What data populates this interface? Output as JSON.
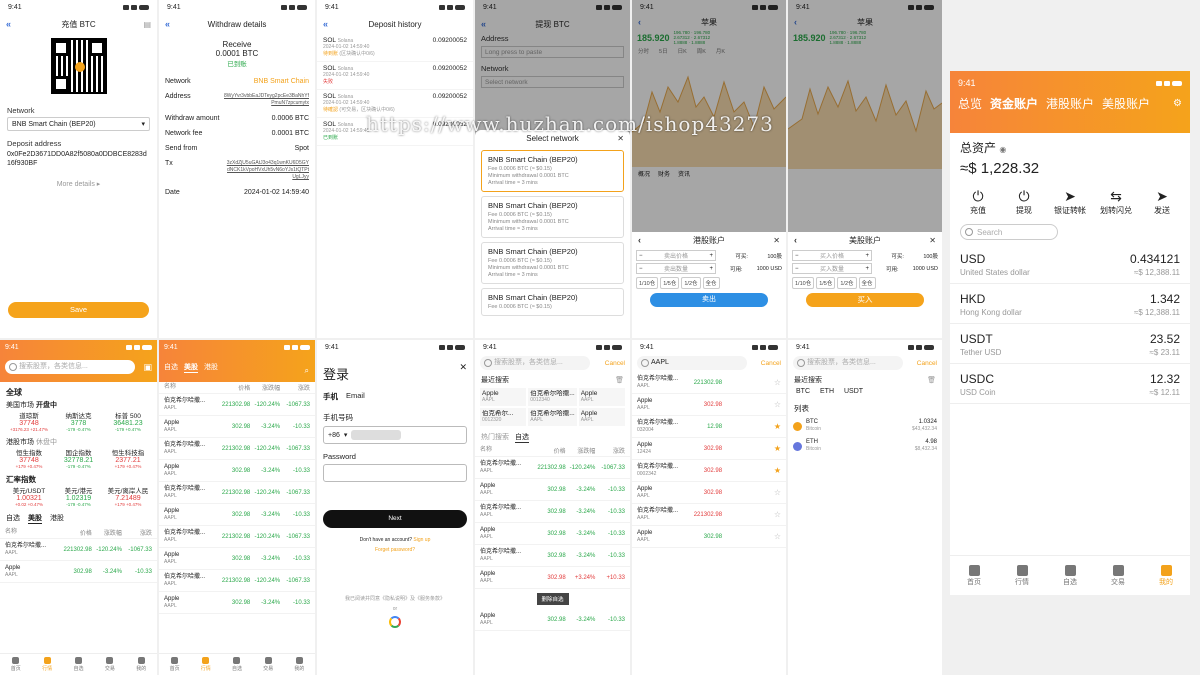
{
  "watermark": "https://www.huzhan.com/ishop43273",
  "time": "9:41",
  "p1": {
    "title": "充值 BTC",
    "network_label": "Network",
    "network_value": "BNB Smart Chain (BEP20)",
    "addr_label": "Deposit address",
    "addr_value": "0x0Fe2D3671DD0A82f5080a0DDBCE8283d16f930BF",
    "more": "More details",
    "save": "Save"
  },
  "p2": {
    "title": "Withdraw details",
    "receive": "Receive",
    "amount": "0.0001 BTC",
    "status": "已到账",
    "rows": [
      {
        "k": "Network",
        "v": "BNB Smart Chain"
      },
      {
        "k": "Address",
        "v": "8WyYvr3vbbEaJDTeyg2pcEe3BaNhYfPmuN7zpcumytx"
      },
      {
        "k": "Withdraw amount",
        "v": "0.0006 BTC"
      },
      {
        "k": "Network fee",
        "v": "0.0001 BTC"
      },
      {
        "k": "Send from",
        "v": "Spot"
      },
      {
        "k": "Tx",
        "v": "3zXdZjU5uGAtJ3o43q1wnKU6D5GYdNCK1kVpoHVxUh5vN6oYJs1tQTPtUgLJyy"
      },
      {
        "k": "Date",
        "v": "2024-01-02 14:59:40"
      }
    ]
  },
  "p3": {
    "title": "Deposit history",
    "items": [
      {
        "coin": "SOL",
        "net": "Solana",
        "amt": "0.09200052",
        "date": "2024-01-02 14:59:40",
        "status": "待到账",
        "note": "(区块确认中0/6)"
      },
      {
        "coin": "SOL",
        "net": "Solana",
        "amt": "0.09200052",
        "date": "2024-01-02 14:59:40",
        "status": "失败",
        "note": ""
      },
      {
        "coin": "SOL",
        "net": "Solana",
        "amt": "0.09200052",
        "date": "2024-01-02 14:59:40",
        "status": "待確認",
        "note": "(可交易，区块确认中0/6)"
      },
      {
        "coin": "SOL",
        "net": "Solana",
        "amt": "0.09200052",
        "date": "2024-01-02 14:59:40",
        "status": "已到账",
        "note": ""
      }
    ]
  },
  "p4": {
    "title": "提现 BTC",
    "address_label": "Address",
    "address_ph": "Long press to paste",
    "network_label": "Network",
    "network_ph": "Select network",
    "sheet_title": "Select network",
    "cards": [
      {
        "name": "BNB Smart Chain (BEP20)",
        "fee": "Fee 0.0006 BTC (≈ $0.15)",
        "min": "Minimum withdrawal 0.0001 BTC",
        "time": "Arrival time ≈ 3 mins"
      },
      {
        "name": "BNB Smart Chain (BEP20)",
        "fee": "Fee 0.0006 BTC (≈ $0.15)",
        "min": "Minimum withdrawal 0.0001 BTC",
        "time": "Arrival time ≈ 3 mins"
      },
      {
        "name": "BNB Smart Chain (BEP20)",
        "fee": "Fee 0.0006 BTC (≈ $0.15)",
        "min": "Minimum withdrawal 0.0001 BTC",
        "time": "Arrival time ≈ 3 mins"
      },
      {
        "name": "BNB Smart Chain (BEP20)",
        "fee": "Fee 0.0006 BTC (≈ $0.15)",
        "min": "",
        "time": ""
      }
    ]
  },
  "p5": {
    "title": "苹果",
    "price": "185.920",
    "tabs": [
      "分时",
      "5日",
      "日K",
      "周K",
      "月K"
    ],
    "subtabs": [
      "概况",
      "财务",
      "资讯"
    ],
    "sheet_title": "港股账户",
    "price_ph": "卖出价格",
    "qty_ph": "卖出数量",
    "buyable_label": "可买:",
    "buyable_val": "100股",
    "avail_label": "可用:",
    "avail_val": "1000 USD",
    "fracs": [
      "1/10仓",
      "1/5仓",
      "1/2仓",
      "全仓"
    ],
    "action": "卖出"
  },
  "p6": {
    "title": "苹果",
    "price": "185.920",
    "sheet_title": "美股账户",
    "price_ph": "买入价格",
    "qty_ph": "买入数量",
    "buyable_label": "可买:",
    "buyable_val": "100股",
    "avail_label": "可用:",
    "avail_val": "1000 USD",
    "fracs": [
      "1/10仓",
      "1/5仓",
      "1/2仓",
      "全仓"
    ],
    "action": "买入"
  },
  "p7": {
    "tabs": [
      "总览",
      "资金账户",
      "港股账户",
      "美股账户"
    ],
    "total_label": "总资产",
    "total": "≈$ 1,228.32",
    "actions": [
      "充值",
      "提现",
      "银证转帐",
      "划转闪兑",
      "发送"
    ],
    "search_ph": "Search",
    "assets": [
      {
        "code": "USD",
        "name": "United States dollar",
        "amt": "0.434121",
        "usd": "≈$ 12,388.11"
      },
      {
        "code": "HKD",
        "name": "Hong Kong dollar",
        "amt": "1.342",
        "usd": "≈$ 12,388.11"
      },
      {
        "code": "USDT",
        "name": "Tether USD",
        "amt": "23.52",
        "usd": "≈$ 23.11"
      },
      {
        "code": "USDC",
        "name": "USD Coin",
        "amt": "12.32",
        "usd": "≈$ 12.11"
      }
    ],
    "tabbar": [
      "首页",
      "行情",
      "自选",
      "交易",
      "我的"
    ]
  },
  "p8": {
    "search_ph": "搜索股票，各类信息...",
    "global": "全球",
    "us_market": "美国市场",
    "us_status": "开盘中",
    "us_idx": [
      {
        "n": "道琼斯",
        "v": "37748",
        "c": "+3176.23 +21.47%"
      },
      {
        "n": "纳斯达克",
        "v": "3778",
        "c": "-179  -0.47%"
      },
      {
        "n": "标普 500",
        "v": "36481.23",
        "c": "-179  +0.47%"
      }
    ],
    "hk_market": "港股市场",
    "hk_status": "休盘中",
    "hk_idx": [
      {
        "n": "恒生指数",
        "v": "37748",
        "c": "+179  +0.47%"
      },
      {
        "n": "国企指数",
        "v": "32778.21",
        "c": "-179  -0.47%"
      },
      {
        "n": "恒生科技指",
        "v": "2377.21",
        "c": "+179  +0.47%"
      }
    ],
    "fx": "汇率指数",
    "fx_idx": [
      {
        "n": "美元/USDT",
        "v": "1.00321",
        "c": "+0.02  +0.47%"
      },
      {
        "n": "美元/港元",
        "v": "1.02319",
        "c": "-179  -0.47%"
      },
      {
        "n": "美元/离岸人民",
        "v": "7.21489",
        "c": "+179  +0.47%"
      }
    ],
    "tabs": [
      "自选",
      "美股",
      "港股"
    ],
    "cols": [
      "名称",
      "价格",
      "涨跌幅",
      "涨跌"
    ],
    "rows": [
      {
        "n": "伯克希尔哈撒...",
        "s": "AAPL",
        "p": "221302.98",
        "c": "-120.24%",
        "d": "-1067.33"
      },
      {
        "n": "Apple",
        "s": "AAPL",
        "p": "302.98",
        "c": "-3.24%",
        "d": "-10.33"
      }
    ],
    "tabbar": [
      "首页",
      "行情",
      "自选",
      "交易",
      "我的"
    ]
  },
  "p9": {
    "tabs": [
      "自选",
      "美股",
      "港股"
    ],
    "cols": [
      "名称",
      "价格",
      "涨跌幅",
      "涨跌"
    ],
    "rows": [
      {
        "n": "伯克希尔哈撒...",
        "s": "AAPL",
        "p": "221302.98",
        "c": "-120.24%",
        "d": "-1067.33"
      },
      {
        "n": "Apple",
        "s": "AAPL",
        "p": "302.98",
        "c": "-3.24%",
        "d": "-10.33"
      },
      {
        "n": "伯克希尔哈撒...",
        "s": "AAPL",
        "p": "221302.98",
        "c": "-120.24%",
        "d": "-1067.33"
      },
      {
        "n": "Apple",
        "s": "AAPL",
        "p": "302.98",
        "c": "-3.24%",
        "d": "-10.33"
      },
      {
        "n": "伯克希尔哈撒...",
        "s": "AAPL",
        "p": "221302.98",
        "c": "-120.24%",
        "d": "-1067.33"
      },
      {
        "n": "Apple",
        "s": "AAPL",
        "p": "302.98",
        "c": "-3.24%",
        "d": "-10.33"
      },
      {
        "n": "伯克希尔哈撒...",
        "s": "AAPL",
        "p": "221302.98",
        "c": "-120.24%",
        "d": "-1067.33"
      },
      {
        "n": "Apple",
        "s": "AAPL",
        "p": "302.98",
        "c": "-3.24%",
        "d": "-10.33"
      },
      {
        "n": "伯克希尔哈撒...",
        "s": "AAPL",
        "p": "221302.98",
        "c": "-120.24%",
        "d": "-1067.33"
      },
      {
        "n": "Apple",
        "s": "AAPL",
        "p": "302.98",
        "c": "-3.24%",
        "d": "-10.33"
      }
    ],
    "tabbar": [
      "首页",
      "行情",
      "自选",
      "交易",
      "我的"
    ]
  },
  "p10": {
    "title": "登录",
    "tab_phone": "手机",
    "tab_email": "Email",
    "phone_label": "手机号码",
    "code": "+86",
    "pwd_label": "Password",
    "next": "Next",
    "no_acc": "Don't have an account?",
    "signup": "Sign up",
    "forgot": "Forget password?",
    "terms": "我已阅读并同意《隐私说明》及《服务条款》",
    "or": "or"
  },
  "p11": {
    "search_ph": "搜索股票，各类信息...",
    "cancel": "Cancel",
    "recent": "最近搜索",
    "recent_items": [
      {
        "n": "Apple",
        "s": "AAPL"
      },
      {
        "n": "伯克希尔哈撒...",
        "s": "0012340"
      },
      {
        "n": "Apple",
        "s": "AAPL"
      },
      {
        "n": "伯克希尔...",
        "s": "0012320"
      },
      {
        "n": "伯克希尔哈撒...",
        "s": "AAPL"
      },
      {
        "n": "Apple",
        "s": "AAPL"
      }
    ],
    "hot": "热门搜索",
    "fav": "自选",
    "cols": [
      "名称",
      "价格",
      "涨跌幅",
      "涨跌"
    ],
    "rows": [
      {
        "n": "伯克希尔哈撒...",
        "s": "AAPL",
        "p": "221302.98",
        "c": "-120.24%",
        "d": "-1067.33",
        "red": false
      },
      {
        "n": "Apple",
        "s": "AAPL",
        "p": "302.98",
        "c": "-3.24%",
        "d": "-10.33",
        "red": false
      },
      {
        "n": "伯克希尔哈撒...",
        "s": "AAPL",
        "p": "302.98",
        "c": "-3.24%",
        "d": "-10.33",
        "red": false
      },
      {
        "n": "Apple",
        "s": "AAPL",
        "p": "302.98",
        "c": "-3.24%",
        "d": "-10.33",
        "red": false
      },
      {
        "n": "伯克希尔哈撒...",
        "s": "AAPL",
        "p": "302.98",
        "c": "-3.24%",
        "d": "-10.33",
        "red": false
      },
      {
        "n": "Apple",
        "s": "AAPL",
        "p": "302.98",
        "c": "+3.24%",
        "d": "+10.33",
        "red": true
      }
    ],
    "delete": "删除自选",
    "last": {
      "n": "Apple",
      "s": "AAPL",
      "p": "302.98",
      "c": "-3.24%",
      "d": "-10.33"
    }
  },
  "p12": {
    "search_val": "AAPL",
    "cancel": "Cancel",
    "rows": [
      {
        "n": "伯克希尔哈撒...",
        "s": "AAPL",
        "p": "221302.98",
        "red": false,
        "star": false
      },
      {
        "n": "Apple",
        "s": "AAPL",
        "p": "302.98",
        "red": true,
        "star": false
      },
      {
        "n": "伯克希尔哈撒...",
        "s": "032004",
        "p": "12.98",
        "red": false,
        "star": true
      },
      {
        "n": "Apple",
        "s": "12424",
        "p": "302.98",
        "red": true,
        "star": true
      },
      {
        "n": "伯克希尔哈撒...",
        "s": "0002342",
        "p": "302.98",
        "red": true,
        "star": true
      },
      {
        "n": "Apple",
        "s": "AAPL",
        "p": "302.98",
        "red": true,
        "star": false
      },
      {
        "n": "伯克希尔哈撒...",
        "s": "AAPL",
        "p": "221302.98",
        "red": true,
        "star": false
      },
      {
        "n": "Apple",
        "s": "AAPL",
        "p": "302.98",
        "red": false,
        "star": false
      }
    ]
  },
  "p13": {
    "search_ph": "搜索股票，各类信息...",
    "cancel": "Cancel",
    "recent": "最近搜索",
    "recent_items": [
      "BTC",
      "ETH",
      "USDT"
    ],
    "list": "列表",
    "coins": [
      {
        "code": "BTC",
        "name": "Bitcoin",
        "amt": "1.0324",
        "usd": "$43,432.34"
      },
      {
        "code": "ETH",
        "name": "Bitcoin",
        "amt": "4.98",
        "usd": "$8,432.34"
      }
    ]
  }
}
